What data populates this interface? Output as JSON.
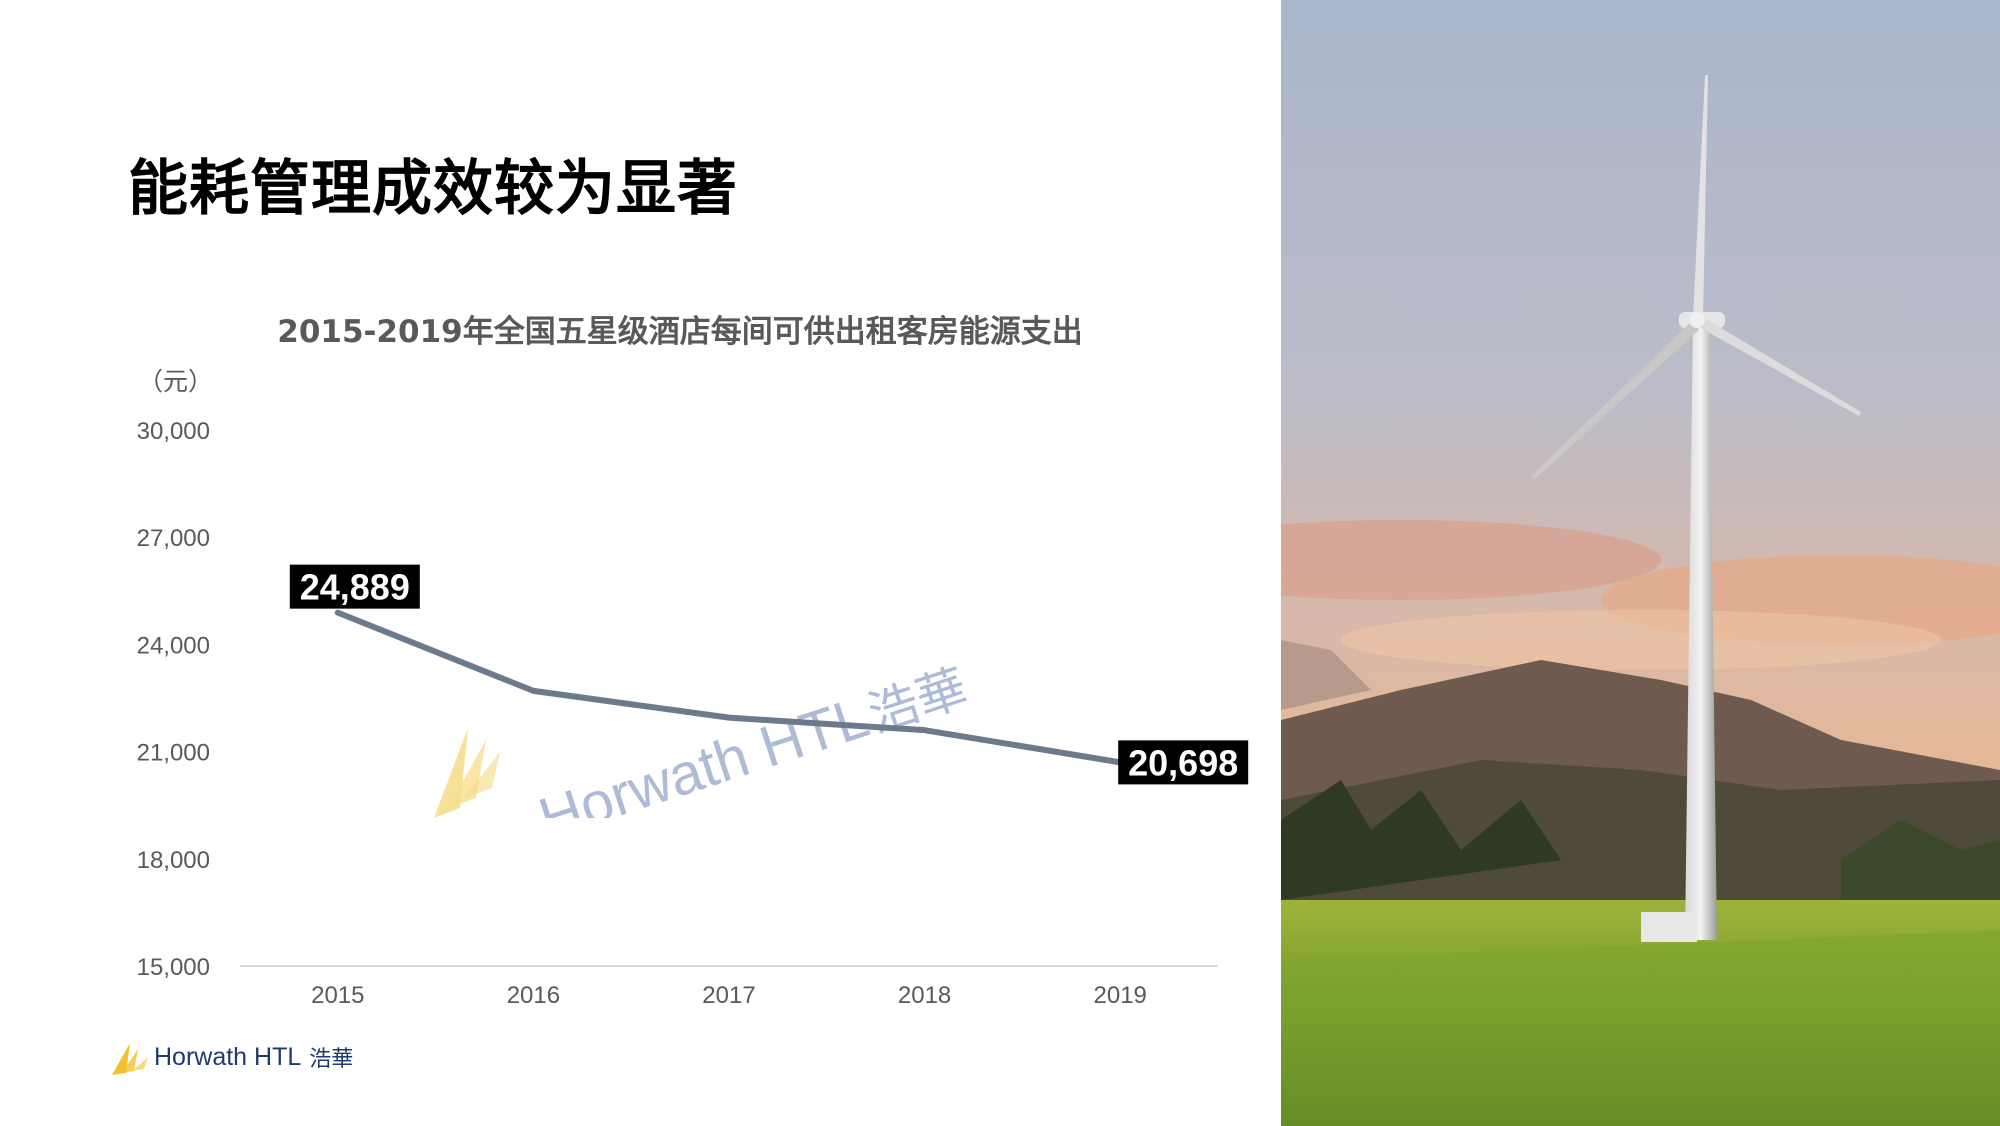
{
  "slide": {
    "title": "能耗管理成效较为显著"
  },
  "chart_data": {
    "type": "line",
    "title": "2015-2019年全国五星级酒店每间可供出租客房能源支出",
    "unit": "（元）",
    "categories": [
      "2015",
      "2016",
      "2017",
      "2018",
      "2019"
    ],
    "values": [
      24889,
      22700,
      21950,
      21600,
      20698
    ],
    "ylim": [
      15000,
      30000
    ],
    "yticks": [
      15000,
      18000,
      21000,
      24000,
      27000,
      30000
    ],
    "ytick_labels": [
      "15,000",
      "18,000",
      "21,000",
      "24,000",
      "27,000",
      "30,000"
    ],
    "data_labels": [
      {
        "index": 0,
        "text": "24,889"
      },
      {
        "index": 4,
        "text": "20,698"
      }
    ],
    "line_color": "#6b7b8c",
    "grid": false
  },
  "watermark": {
    "text": "Horwath HTL",
    "cn": "浩華"
  },
  "footer": {
    "brand": "Horwath HTL",
    "brand_cn": "浩華",
    "brand_color": "#1f3a6d",
    "accent": "#f2c12e"
  }
}
